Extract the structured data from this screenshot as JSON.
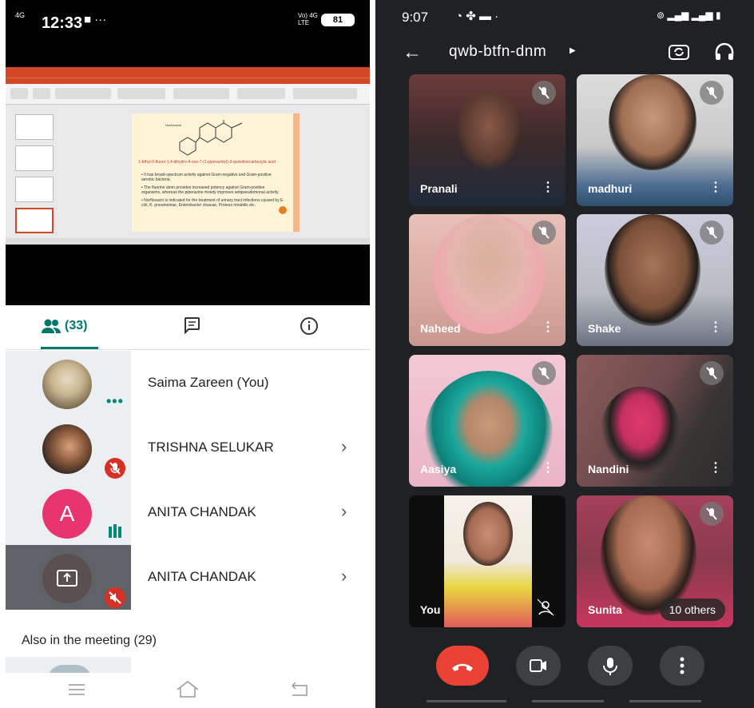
{
  "left_phone": {
    "status": {
      "time": "12:33",
      "signal": "4G",
      "network": "Vo) 4G LTE",
      "battery": "81"
    },
    "tabs": {
      "people_count": "(33)"
    },
    "participants": [
      {
        "name": "Saima Zareen (You)",
        "avatar": "photo",
        "indicator": "dots"
      },
      {
        "name": "TRISHNA SELUKAR",
        "avatar": "photo",
        "indicator": "muted"
      },
      {
        "name": "ANITA CHANDAK",
        "avatar": "A",
        "indicator": "speaking"
      },
      {
        "name": "ANITA CHANDAK",
        "avatar": "present",
        "indicator": "muted"
      }
    ],
    "also_in_meeting": "Also in the meeting (29)"
  },
  "right_phone": {
    "status": {
      "time": "9:07"
    },
    "meeting_code": "qwb-btfn-dnm",
    "tiles": [
      {
        "name": "Pranali",
        "muted": true
      },
      {
        "name": "madhuri",
        "muted": true
      },
      {
        "name": "Naheed",
        "muted": true
      },
      {
        "name": "Shake",
        "muted": true
      },
      {
        "name": "Aasiya",
        "muted": true
      },
      {
        "name": "Nandini",
        "muted": true
      },
      {
        "name": "You",
        "muted": false
      },
      {
        "name": "Sunita",
        "muted": true
      }
    ],
    "others_label": "10 others"
  },
  "colors": {
    "teal": "#00796b",
    "end_call": "#ea4335",
    "mute_red": "#d93025",
    "avatar_pink": "#e8356f"
  }
}
